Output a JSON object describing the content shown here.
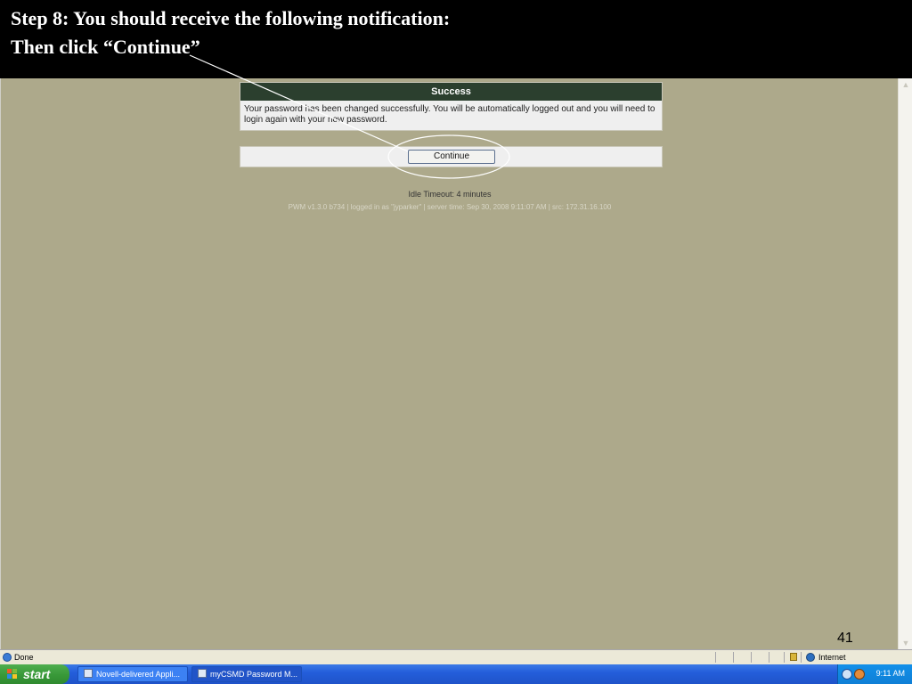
{
  "slide": {
    "line1": "Step 8: You should receive the following notification:",
    "line2": "Then click “Continue”",
    "page_number": "41"
  },
  "dialog": {
    "title": "Success",
    "message": "Your password has been changed successfully. You will be automatically logged out and you will need to login again with your new password.",
    "continue_label": "Continue"
  },
  "page": {
    "idle_timeout": "Idle Timeout: 4 minutes",
    "footer_info": "PWM v1.3.0 b734  |  logged in as \"jyparker\"  |  server time: Sep 30, 2008 9:11:07 AM  |  src: 172.31.16.100"
  },
  "statusbar": {
    "status": "Done",
    "zone": "Internet"
  },
  "taskbar": {
    "start_label": "start",
    "tasks": [
      {
        "label": "Novell-delivered Appli..."
      },
      {
        "label": "myCSMD Password M..."
      }
    ],
    "clock": "9:11 AM"
  },
  "colors": {
    "page_background": "#ada98b",
    "dialog_header": "#2b3f2e",
    "taskbar_blue": "#245edb",
    "start_green": "#3a9a3a"
  },
  "icons": [
    "ie-page-icon",
    "lock-icon",
    "globe-icon",
    "windows-flag-icon",
    "window-icon",
    "tray-network-icon",
    "tray-app-icon",
    "scroll-up-icon",
    "scroll-down-icon"
  ]
}
